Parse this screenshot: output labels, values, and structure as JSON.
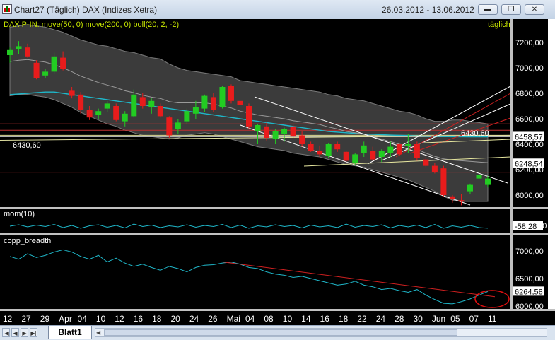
{
  "window": {
    "title": "Chart27 (Täglich)  DAX (Indizes Xetra)",
    "date_range": "26.03.2012 - 13.06.2012",
    "minimize_icon": "minimize-icon",
    "restore_icon": "restore-icon",
    "close_icon": "close-icon"
  },
  "price_panel": {
    "label": "DAX P-IN: move(50, 0) move(200, 0) boll(20, 2, -2)",
    "period": "täglich",
    "y_ticks": [
      "7200,00",
      "7000,00",
      "6800,00",
      "6600,00",
      "6400,00",
      "6200,00",
      "6000,00"
    ],
    "line_label": "6430,60",
    "markers": [
      {
        "text": "6458,57",
        "bg": "#ffffff",
        "fg": "#000000"
      },
      {
        "text": "6248,54",
        "bg": "#ffffff",
        "fg": "#000000"
      }
    ]
  },
  "momentum_panel": {
    "label": "mom(10)",
    "y_ticks": [
      "0,00"
    ],
    "marker": "-58,28"
  },
  "breadth_panel": {
    "label": "copp_breadth",
    "y_ticks": [
      "7000,00",
      "6500,00",
      "6000,00"
    ],
    "marker": "6264,58"
  },
  "x_axis": {
    "labels": [
      "12",
      "27",
      "29",
      "Apr",
      "04",
      "10",
      "12",
      "16",
      "18",
      "20",
      "24",
      "26",
      "Mai",
      "04",
      "08",
      "10",
      "14",
      "16",
      "18",
      "22",
      "24",
      "28",
      "30",
      "Jun",
      "05",
      "07",
      "11"
    ]
  },
  "sheet": {
    "tab_label": "Blatt1"
  },
  "colors": {
    "background": "#000000",
    "up_candle": "#22cc22",
    "down_candle": "#e81c1c",
    "ma50": "#1fb7c9",
    "bollinger_fill": "#3b3b3b",
    "trend_white": "#ffffff",
    "trend_red": "#d02020",
    "label_yellow": "#c8e600"
  },
  "chart_data": [
    {
      "type": "candlestick",
      "title": "DAX P-IN: move(50, 0) move(200, 0) boll(20, 2, -2)",
      "ylim": [
        5900,
        7300
      ],
      "candles": [
        {
          "o": 7100,
          "h": 7160,
          "l": 7040,
          "c": 7140
        },
        {
          "o": 7150,
          "h": 7210,
          "l": 7110,
          "c": 7170
        },
        {
          "o": 7160,
          "h": 7190,
          "l": 7080,
          "c": 7090
        },
        {
          "o": 7040,
          "h": 7060,
          "l": 6910,
          "c": 6920
        },
        {
          "o": 6940,
          "h": 6990,
          "l": 6920,
          "c": 6970
        },
        {
          "o": 6970,
          "h": 7120,
          "l": 6950,
          "c": 7090
        },
        {
          "o": 7080,
          "h": 7130,
          "l": 6980,
          "c": 6990
        },
        {
          "o": 6820,
          "h": 6850,
          "l": 6760,
          "c": 6780
        },
        {
          "o": 6790,
          "h": 6810,
          "l": 6640,
          "c": 6670
        },
        {
          "o": 6670,
          "h": 6700,
          "l": 6590,
          "c": 6610
        },
        {
          "o": 6630,
          "h": 6680,
          "l": 6600,
          "c": 6660
        },
        {
          "o": 6680,
          "h": 6740,
          "l": 6650,
          "c": 6720
        },
        {
          "o": 6700,
          "h": 6720,
          "l": 6580,
          "c": 6590
        },
        {
          "o": 6580,
          "h": 6660,
          "l": 6540,
          "c": 6640
        },
        {
          "o": 6620,
          "h": 6830,
          "l": 6610,
          "c": 6790
        },
        {
          "o": 6770,
          "h": 6800,
          "l": 6680,
          "c": 6700
        },
        {
          "o": 6690,
          "h": 6760,
          "l": 6640,
          "c": 6740
        },
        {
          "o": 6700,
          "h": 6720,
          "l": 6610,
          "c": 6620
        },
        {
          "o": 6610,
          "h": 6620,
          "l": 6450,
          "c": 6470
        },
        {
          "o": 6520,
          "h": 6600,
          "l": 6480,
          "c": 6570
        },
        {
          "o": 6580,
          "h": 6680,
          "l": 6560,
          "c": 6660
        },
        {
          "o": 6640,
          "h": 6740,
          "l": 6600,
          "c": 6690
        },
        {
          "o": 6680,
          "h": 6790,
          "l": 6650,
          "c": 6780
        },
        {
          "o": 6770,
          "h": 6800,
          "l": 6650,
          "c": 6670
        },
        {
          "o": 6690,
          "h": 6860,
          "l": 6680,
          "c": 6850
        },
        {
          "o": 6860,
          "h": 6870,
          "l": 6720,
          "c": 6740
        },
        {
          "o": 6740,
          "h": 6760,
          "l": 6700,
          "c": 6710
        },
        {
          "o": 6700,
          "h": 6720,
          "l": 6520,
          "c": 6540
        },
        {
          "o": 6500,
          "h": 6560,
          "l": 6400,
          "c": 6550
        },
        {
          "o": 6540,
          "h": 6570,
          "l": 6430,
          "c": 6450
        },
        {
          "o": 6440,
          "h": 6520,
          "l": 6400,
          "c": 6500
        },
        {
          "o": 6480,
          "h": 6530,
          "l": 6420,
          "c": 6520
        },
        {
          "o": 6540,
          "h": 6560,
          "l": 6450,
          "c": 6460
        },
        {
          "o": 6470,
          "h": 6500,
          "l": 6380,
          "c": 6400
        },
        {
          "o": 6400,
          "h": 6420,
          "l": 6340,
          "c": 6350
        },
        {
          "o": 6350,
          "h": 6390,
          "l": 6300,
          "c": 6320
        },
        {
          "o": 6310,
          "h": 6410,
          "l": 6290,
          "c": 6400
        },
        {
          "o": 6400,
          "h": 6420,
          "l": 6340,
          "c": 6360
        },
        {
          "o": 6340,
          "h": 6350,
          "l": 6260,
          "c": 6270
        },
        {
          "o": 6250,
          "h": 6330,
          "l": 6240,
          "c": 6320
        },
        {
          "o": 6330,
          "h": 6420,
          "l": 6300,
          "c": 6390
        },
        {
          "o": 6350,
          "h": 6380,
          "l": 6270,
          "c": 6280
        },
        {
          "o": 6300,
          "h": 6360,
          "l": 6260,
          "c": 6350
        },
        {
          "o": 6330,
          "h": 6420,
          "l": 6300,
          "c": 6380
        },
        {
          "o": 6400,
          "h": 6410,
          "l": 6310,
          "c": 6320
        },
        {
          "o": 6390,
          "h": 6480,
          "l": 6330,
          "c": 6400
        },
        {
          "o": 6400,
          "h": 6420,
          "l": 6270,
          "c": 6290
        },
        {
          "o": 6280,
          "h": 6300,
          "l": 6220,
          "c": 6230
        },
        {
          "o": 6230,
          "h": 6250,
          "l": 6170,
          "c": 6180
        },
        {
          "o": 6210,
          "h": 6230,
          "l": 5990,
          "c": 6000
        },
        {
          "o": 5990,
          "h": 6000,
          "l": 5940,
          "c": 5970
        },
        {
          "o": 5960,
          "h": 6010,
          "l": 5920,
          "c": 5950
        },
        {
          "o": 6030,
          "h": 6090,
          "l": 6010,
          "c": 6080
        },
        {
          "o": 6130,
          "h": 6220,
          "l": 6110,
          "c": 6160
        },
        {
          "o": 6080,
          "h": 6150,
          "l": 6060,
          "c": 6130
        }
      ],
      "bollinger_upper": [
        7320,
        7330,
        7340,
        7330,
        7320,
        7300,
        7280,
        7250,
        7220,
        7200,
        7180,
        7170,
        7150,
        7130,
        7120,
        7100,
        7080,
        7070,
        7030,
        7000,
        6980,
        6970,
        6960,
        6950,
        6940,
        6930,
        6900,
        6890,
        6880,
        6870,
        6860,
        6850,
        6840,
        6830,
        6820,
        6810,
        6790,
        6780,
        6760,
        6750,
        6740,
        6720,
        6700,
        6680,
        6660,
        6650,
        6630,
        6600,
        6580,
        6580,
        6590,
        6590,
        6580,
        6570,
        6560
      ],
      "bollinger_lower": [
        6780,
        6790,
        6790,
        6780,
        6770,
        6750,
        6720,
        6690,
        6650,
        6620,
        6590,
        6560,
        6540,
        6510,
        6490,
        6470,
        6460,
        6450,
        6440,
        6450,
        6470,
        6480,
        6490,
        6480,
        6460,
        6440,
        6420,
        6400,
        6380,
        6370,
        6360,
        6350,
        6330,
        6320,
        6310,
        6300,
        6280,
        6260,
        6240,
        6230,
        6220,
        6200,
        6180,
        6160,
        6140,
        6120,
        6090,
        6060,
        6030,
        5990,
        5960,
        5950,
        5950,
        5950,
        5950
      ],
      "moving_average": [
        6790,
        6795,
        6800,
        6805,
        6810,
        6810,
        6800,
        6790,
        6780,
        6770,
        6760,
        6750,
        6740,
        6730,
        6720,
        6710,
        6700,
        6690,
        6680,
        6670,
        6660,
        6650,
        6640,
        6630,
        6620,
        6610,
        6600,
        6590,
        6580,
        6570,
        6560,
        6550,
        6540,
        6530,
        6520,
        6510,
        6500,
        6495,
        6490,
        6485,
        6480,
        6478,
        6475,
        6472,
        6470,
        6468,
        6465,
        6463,
        6462,
        6460,
        6459,
        6459,
        6458,
        6458,
        6458
      ],
      "levels": [
        6430.6,
        6458.57,
        6248.54
      ]
    },
    {
      "type": "line",
      "title": "mom(10)",
      "values": [
        0,
        40,
        -20,
        30,
        -10,
        50,
        -40,
        20,
        -60,
        10,
        40,
        -30,
        20,
        -50,
        60,
        -10,
        30,
        -40,
        10,
        -20,
        40,
        -30,
        20,
        -10,
        50,
        -40,
        30,
        -60,
        10,
        -20,
        40,
        -10,
        20,
        -50,
        30,
        -20,
        10,
        -40,
        60,
        -30,
        20,
        -10,
        40,
        -50,
        20,
        -20,
        30,
        -40,
        50,
        -60,
        10,
        -30,
        20,
        -40,
        -58.28
      ],
      "ylim": [
        -200,
        200
      ]
    },
    {
      "type": "line",
      "title": "copp_breadth",
      "values": [
        6900,
        6850,
        6950,
        6880,
        6920,
        6980,
        7020,
        6980,
        6900,
        6850,
        6920,
        6800,
        6870,
        6780,
        6720,
        6760,
        6700,
        6650,
        6720,
        6680,
        6620,
        6700,
        6740,
        6750,
        6780,
        6800,
        6760,
        6700,
        6680,
        6620,
        6580,
        6560,
        6520,
        6540,
        6500,
        6460,
        6420,
        6380,
        6400,
        6450,
        6380,
        6350,
        6300,
        6320,
        6280,
        6250,
        6300,
        6200,
        6120,
        6050,
        6040,
        6080,
        6130,
        6200,
        6264.58
      ],
      "ylim": [
        5950,
        7100
      ]
    }
  ]
}
